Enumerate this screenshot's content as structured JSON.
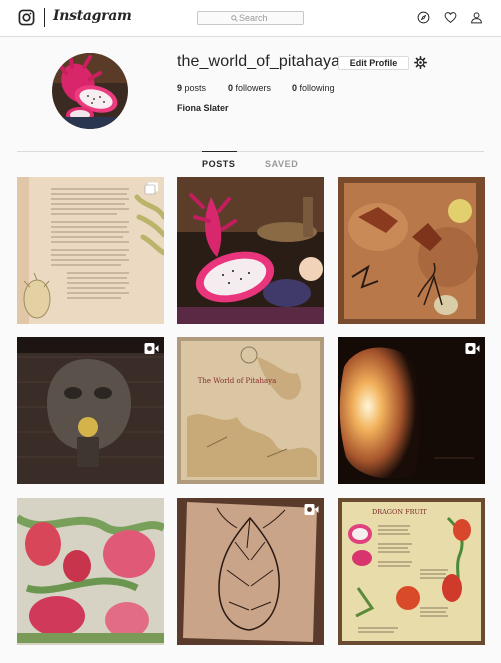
{
  "app": {
    "brand": "Instagram"
  },
  "search": {
    "placeholder": "Search"
  },
  "profile": {
    "username": "the_world_of_pitahaya",
    "edit_label": "Edit Profile",
    "full_name": "Fiona Slater",
    "posts_count": "9",
    "posts_label": "posts",
    "followers_count": "0",
    "followers_label": "followers",
    "following_count": "0",
    "following_label": "following"
  },
  "tabs": [
    {
      "label": "POSTS",
      "active": true
    },
    {
      "label": "SAVED",
      "active": false
    }
  ],
  "posts": [
    {
      "subject": "manuscript page with dragon fruit sketch",
      "badge": "carousel-icon"
    },
    {
      "subject": "dragon fruit still life",
      "badge": ""
    },
    {
      "subject": "cave painting with dragon fruit",
      "badge": ""
    },
    {
      "subject": "stone face fountain",
      "badge": "video-icon"
    },
    {
      "subject": "old map",
      "badge": ""
    },
    {
      "subject": "glowing salt lamp",
      "badge": "video-icon"
    },
    {
      "subject": "pink flowers painting",
      "badge": ""
    },
    {
      "subject": "dragon fruit ink drawing",
      "badge": "video-icon"
    },
    {
      "subject": "dragon fruit botanical page",
      "badge": ""
    }
  ],
  "post_texts": {
    "map_title": "The World of Pitahaya",
    "botanical_title": "DRAGON FRUIT"
  },
  "colors": {
    "border": "#dbdbdb",
    "text": "#262626",
    "muted": "#999999",
    "background": "#fafafa"
  }
}
